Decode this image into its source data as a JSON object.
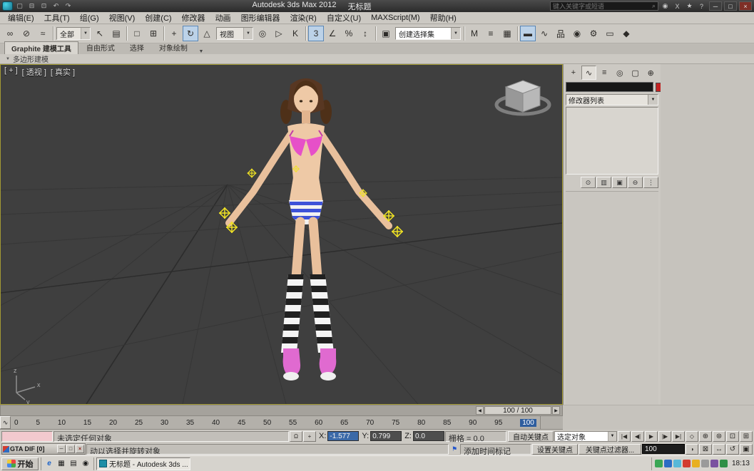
{
  "titlebar": {
    "app_title": "Autodesk 3ds Max 2012",
    "doc_title": "无标题",
    "search_placeholder": "键入关键字或短语"
  },
  "menubar": {
    "items": [
      "编辑(E)",
      "工具(T)",
      "组(G)",
      "视图(V)",
      "创建(C)",
      "修改器",
      "动画",
      "图形编辑器",
      "渲染(R)",
      "自定义(U)",
      "MAXScript(M)",
      "帮助(H)"
    ]
  },
  "toolbar": {
    "selection_filter": "全部",
    "coord_system": "视图",
    "named_sets": "创建选择集",
    "snap_value": "3"
  },
  "ribbon": {
    "tabs": [
      "Graphite 建模工具",
      "自由形式",
      "选择",
      "对象绘制"
    ],
    "subpanel": "多边形建模"
  },
  "viewport": {
    "label_menu": "[ + ]",
    "label_view": "[ 透视 ]",
    "label_shading": "[ 真实 ]"
  },
  "command_panel": {
    "modifier_list": "修改器列表"
  },
  "time_slider": {
    "value": "100 / 100"
  },
  "trackbar": {
    "ticks": [
      "0",
      "5",
      "10",
      "15",
      "20",
      "25",
      "30",
      "35",
      "40",
      "45",
      "50",
      "55",
      "60",
      "65",
      "70",
      "75",
      "80",
      "85",
      "90",
      "95",
      "100"
    ]
  },
  "status": {
    "selection": "未选定任何对象",
    "x_label": "X:",
    "x_value": "-1.577",
    "y_label": "Y:",
    "y_value": "0.799",
    "z_label": "Z:",
    "z_value": "0.0",
    "grid": "栅格 = 0.0",
    "prompt": "动以选择并旋转对象",
    "add_time_tag": "添加时间标记",
    "mini_window_title": "GTA DIF [0]"
  },
  "animation": {
    "auto_key": "自动关键点",
    "set_key": "设置关键点",
    "selection_set": "选定对象",
    "key_filters": "关键点过滤器...",
    "current_frame": "100"
  },
  "taskbar": {
    "start": "开始",
    "task": "无标题 - Autodesk 3ds ...",
    "clock": "18:13"
  },
  "colors": {
    "viewport_bg": "#3f3f3f",
    "selection_gizmo_yellow": "#f0e224",
    "object_color_swatch": "#c42222",
    "active_tool_highlight": "#bcd2e8",
    "trackbar_frame_highlight": "#2e5d9e",
    "bikini_pink": "#e650c8",
    "panties_stripe_blue": "#3d52d8"
  },
  "icons": {
    "new": "▢",
    "open": "⊟",
    "save": "⊡",
    "undo": "↶",
    "redo": "↷",
    "search": "⌕",
    "user": "◉",
    "exchange": "X",
    "favorites": "★",
    "help": "?",
    "minimize": "─",
    "maximize": "□",
    "close": "×",
    "win_restore": "□",
    "link": "∞",
    "unlink": "⊘",
    "bind": "≈",
    "select": "↖",
    "by_name": "▤",
    "region": "□",
    "win_cross": "⊞",
    "move": "+",
    "rotate": "↻",
    "scale": "△",
    "pivot": "◎",
    "manipulate": "▷",
    "kbd": "K",
    "angle": "∠",
    "percent": "%",
    "spin": "↕",
    "edit_sets": "▣",
    "mirror": "M",
    "align": "≡",
    "layers": "▦",
    "ribbon_toggle": "▬",
    "curve": "∿",
    "schematic": "品",
    "material": "◉",
    "rsetup": "⚙",
    "rframe": "▭",
    "render": "◆",
    "arrow_down": "▼",
    "cp_create": "+",
    "cp_modify": "∿",
    "cp_hier": "≡",
    "cp_motion": "◎",
    "cp_display": "▢",
    "cp_util": "⊕",
    "pin": "⊙",
    "show_end": "▥",
    "unique": "▣",
    "remove": "⊖",
    "config": "⋮",
    "lock": "Ω",
    "abs_mode": "+",
    "flag": "⚑",
    "go_start": "|◀",
    "prev": "◀|",
    "play": "▶",
    "next": "|▶",
    "go_end": "▶|",
    "key_mode": "◇",
    "time_cfg": "◑",
    "nav_zoom": "⊕",
    "nav_zoom_all": "⊛",
    "nav_ext": "⊡",
    "nav_ext_all": "⊞",
    "nav_region": "⊠",
    "nav_pan": "↔",
    "nav_orbit": "↺",
    "nav_max": "▣",
    "curve_btn": "∿",
    "ie": "e",
    "desktop": "▦",
    "folder": "▤",
    "media": "◉",
    "ts_left": "◀",
    "ts_right": "▶"
  }
}
